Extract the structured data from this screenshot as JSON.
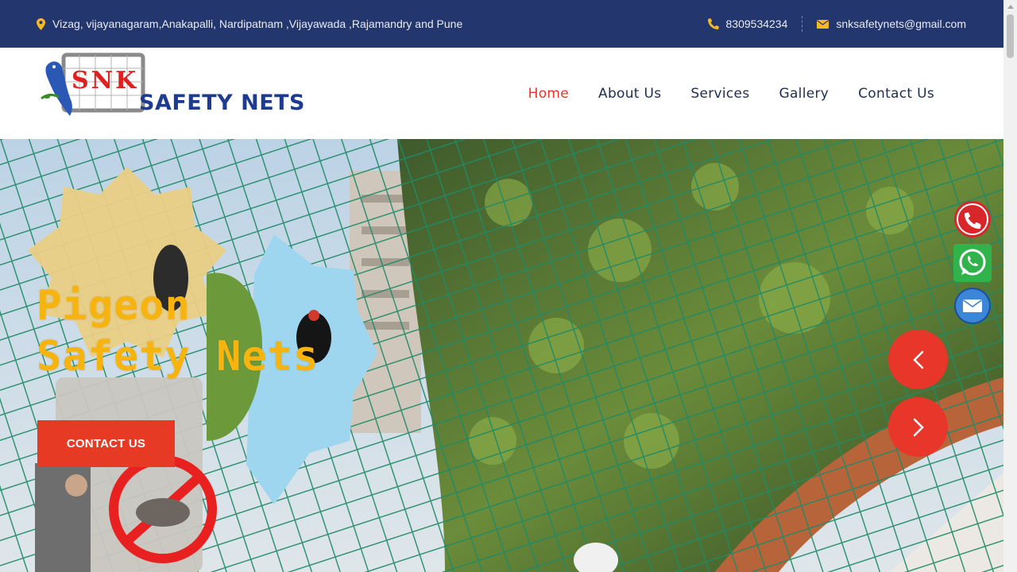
{
  "topbar": {
    "locations": "Vizag, vijayanagaram,Anakapalli, Nardipatnam ,Vijayawada ,Rajamandry and Pune",
    "phone": "8309534234",
    "email": "snksafetynets@gmail.com"
  },
  "logo": {
    "badge_text": "SNK",
    "name": "SAFETY NETS"
  },
  "nav": {
    "items": [
      {
        "label": "Home"
      },
      {
        "label": "About Us"
      },
      {
        "label": "Services"
      },
      {
        "label": "Gallery"
      },
      {
        "label": "Contact Us"
      }
    ],
    "active": "Home"
  },
  "hero": {
    "title_line1": "Pigeon",
    "title_line2": "Safety Nets",
    "cta_label": "CONTACT US",
    "prev_icon": "chevron-left-icon",
    "next_icon": "chevron-right-icon"
  },
  "floating": {
    "icons": [
      "phone-call-icon",
      "whatsapp-icon",
      "email-icon"
    ]
  },
  "colors": {
    "topbar_bg": "#23366d",
    "accent_red": "#e63a25",
    "accent_yellow": "#f7b40f",
    "nav_text": "#1e2d52",
    "brand_blue": "#1f3b8f",
    "net_green": "#1f8a66"
  }
}
